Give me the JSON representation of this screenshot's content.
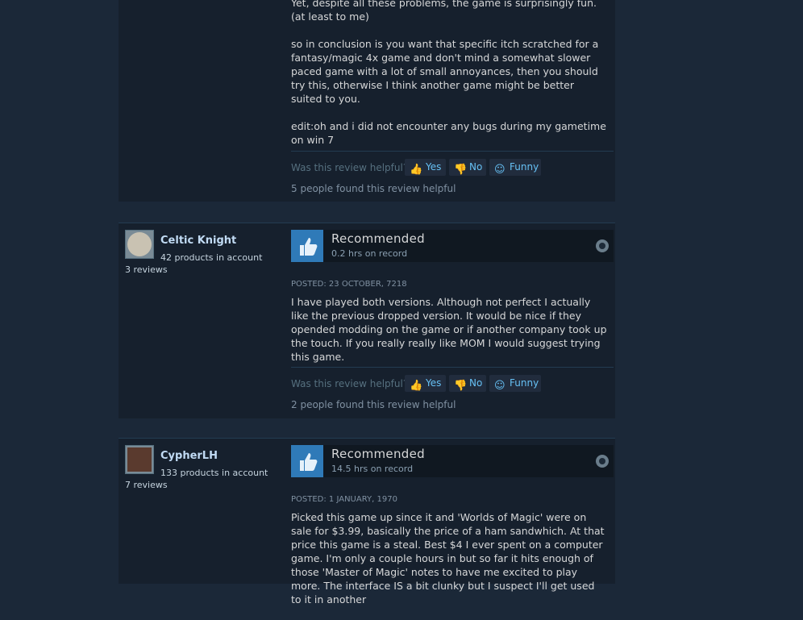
{
  "reviews": [
    {
      "body": [
        "Yet, despite all these problems, the game is surprisingly fun. (at least to me)",
        "so in conclusion is you want that specific itch scratched for a fantasy/magic 4x game and don't mind a somewhat slower paced game with a lot of small annoyances, then you should try this, otherwise I think another game might be better suited to you.",
        "edit:oh and i did not encounter any bugs during my gametime on win 7"
      ],
      "helpful_question": "Was this review helpful?",
      "yes_label": "Yes",
      "no_label": "No",
      "funny_label": "Funny",
      "helpful_count": "5 people found this review helpful"
    },
    {
      "user": {
        "name": "Celtic Knight",
        "products": "42 products in account",
        "reviews": "3 reviews"
      },
      "verdict": "Recommended",
      "hours": "0.2 hrs on record",
      "posted": "POSTED: 23 OCTOBER, 7218",
      "body": [
        "I have played both versions. Although not perfect I actually like the previous dropped version. It would be nice if they opended modding on the game or if another company took up the touch. If you really really like MOM I would suggest trying this game."
      ],
      "helpful_question": "Was this review helpful?",
      "yes_label": "Yes",
      "no_label": "No",
      "funny_label": "Funny",
      "helpful_count": "2 people found this review helpful"
    },
    {
      "user": {
        "name": "CypherLH",
        "products": "133 products in account",
        "reviews": "7 reviews"
      },
      "verdict": "Recommended",
      "hours": "14.5 hrs on record",
      "posted": "POSTED: 1 JANUARY, 1970",
      "body": [
        "Picked this game up since it and 'Worlds of Magic' were on sale for $3.99, basically the price of a ham sandwhich. At that price this game is a steal. Best $4 I ever spent on a computer game. I'm only a couple hours in but so far it hits enough of those 'Master of Magic' notes to have me excited to play more. The interface IS a bit clunky but I suspect I'll get used to it in another"
      ]
    }
  ]
}
